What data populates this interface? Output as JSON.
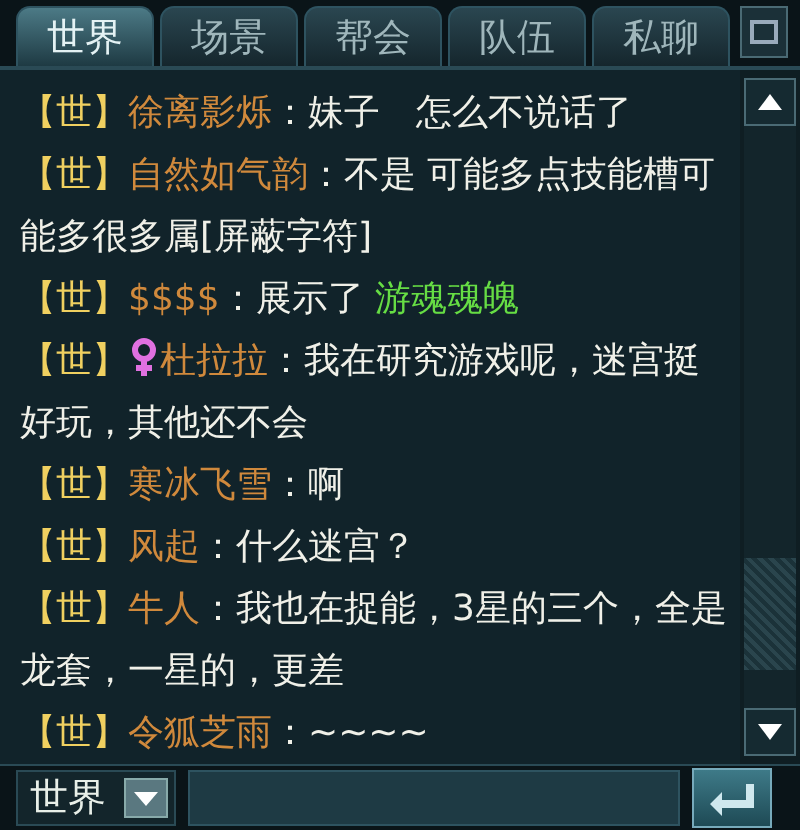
{
  "tabs": [
    {
      "label": "世界",
      "selected": true
    },
    {
      "label": "场景",
      "selected": false
    },
    {
      "label": "帮会",
      "selected": false
    },
    {
      "label": "队伍",
      "selected": false
    },
    {
      "label": "私聊",
      "selected": false
    }
  ],
  "messages": [
    {
      "channel": "【世】",
      "name": "徐离影烁",
      "female": false,
      "text": "：妹子　怎么不说话了"
    },
    {
      "channel": "【世】",
      "name": "自然如气韵",
      "female": false,
      "text": "：不是 可能多点技能槽可能多很多属[屏蔽字符]"
    },
    {
      "channel": "【世】",
      "name": "$$$$",
      "female": false,
      "text": "：展示了 ",
      "item": "游魂魂魄"
    },
    {
      "channel": "【世】",
      "name": "杜拉拉",
      "female": true,
      "text": "：我在研究游戏呢，迷宫挺好玩，其他还不会"
    },
    {
      "channel": "【世】",
      "name": "寒冰飞雪",
      "female": false,
      "text": "：啊"
    },
    {
      "channel": "【世】",
      "name": "风起",
      "female": false,
      "text": "：什么迷宫？"
    },
    {
      "channel": "【世】",
      "name": "牛人",
      "female": false,
      "text": "：我也在捉能，3星的三个，全是龙套，一星的，更差"
    },
    {
      "channel": "【世】",
      "name": "令狐芝雨",
      "female": false,
      "text": "：~~~~"
    }
  ],
  "input": {
    "channel": "世界"
  }
}
